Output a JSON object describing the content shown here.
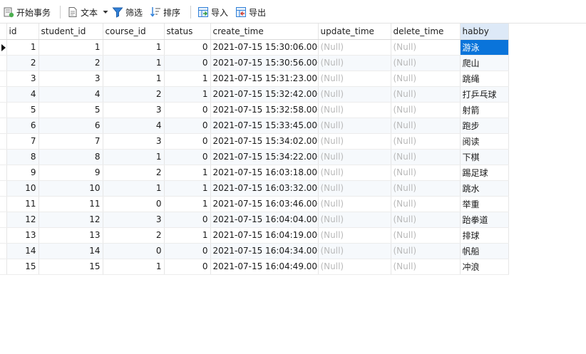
{
  "toolbar": {
    "begin_transaction": "开始事务",
    "text": "文本",
    "filter": "筛选",
    "sort": "排序",
    "import": "导入",
    "export": "导出"
  },
  "table": {
    "columns": [
      "id",
      "student_id",
      "course_id",
      "status",
      "create_time",
      "update_time",
      "delete_time",
      "habby"
    ],
    "rows": [
      [
        "1",
        "1",
        "1",
        "0",
        "2021-07-15 15:30:06.0000",
        "(Null)",
        "(Null)",
        "游泳"
      ],
      [
        "2",
        "2",
        "1",
        "0",
        "2021-07-15 15:30:56.0000",
        "(Null)",
        "(Null)",
        "爬山"
      ],
      [
        "3",
        "3",
        "1",
        "1",
        "2021-07-15 15:31:23.0000",
        "(Null)",
        "(Null)",
        "跳绳"
      ],
      [
        "4",
        "4",
        "2",
        "1",
        "2021-07-15 15:32:42.0000",
        "(Null)",
        "(Null)",
        "打乒乓球"
      ],
      [
        "5",
        "5",
        "3",
        "0",
        "2021-07-15 15:32:58.0000",
        "(Null)",
        "(Null)",
        "射箭"
      ],
      [
        "6",
        "6",
        "4",
        "0",
        "2021-07-15 15:33:45.0000",
        "(Null)",
        "(Null)",
        "跑步"
      ],
      [
        "7",
        "7",
        "3",
        "0",
        "2021-07-15 15:34:02.0000",
        "(Null)",
        "(Null)",
        "阅读"
      ],
      [
        "8",
        "8",
        "1",
        "0",
        "2021-07-15 15:34:22.0000",
        "(Null)",
        "(Null)",
        "下棋"
      ],
      [
        "9",
        "9",
        "2",
        "1",
        "2021-07-15 16:03:18.0000",
        "(Null)",
        "(Null)",
        "踢足球"
      ],
      [
        "10",
        "10",
        "1",
        "1",
        "2021-07-15 16:03:32.0000",
        "(Null)",
        "(Null)",
        "跳水"
      ],
      [
        "11",
        "11",
        "0",
        "1",
        "2021-07-15 16:03:46.0000",
        "(Null)",
        "(Null)",
        "举重"
      ],
      [
        "12",
        "12",
        "3",
        "0",
        "2021-07-15 16:04:04.0000",
        "(Null)",
        "(Null)",
        "跆拳道"
      ],
      [
        "13",
        "13",
        "2",
        "1",
        "2021-07-15 16:04:19.0000",
        "(Null)",
        "(Null)",
        "排球"
      ],
      [
        "14",
        "14",
        "0",
        "0",
        "2021-07-15 16:04:34.0000",
        "(Null)",
        "(Null)",
        "帆船"
      ],
      [
        "15",
        "15",
        "1",
        "0",
        "2021-07-15 16:04:49.0000",
        "(Null)",
        "(Null)",
        "冲浪"
      ]
    ]
  },
  "colors": {
    "selected_cell": "#0a74da",
    "selected_header": "#dde9f7",
    "null_text": "#b9b9b9",
    "alt_row": "#f6f9fc"
  },
  "icons": {
    "begin_transaction": "transaction-icon",
    "text": "document-icon",
    "filter": "funnel-icon",
    "sort": "sort-icon",
    "import": "import-icon",
    "export": "export-icon"
  }
}
